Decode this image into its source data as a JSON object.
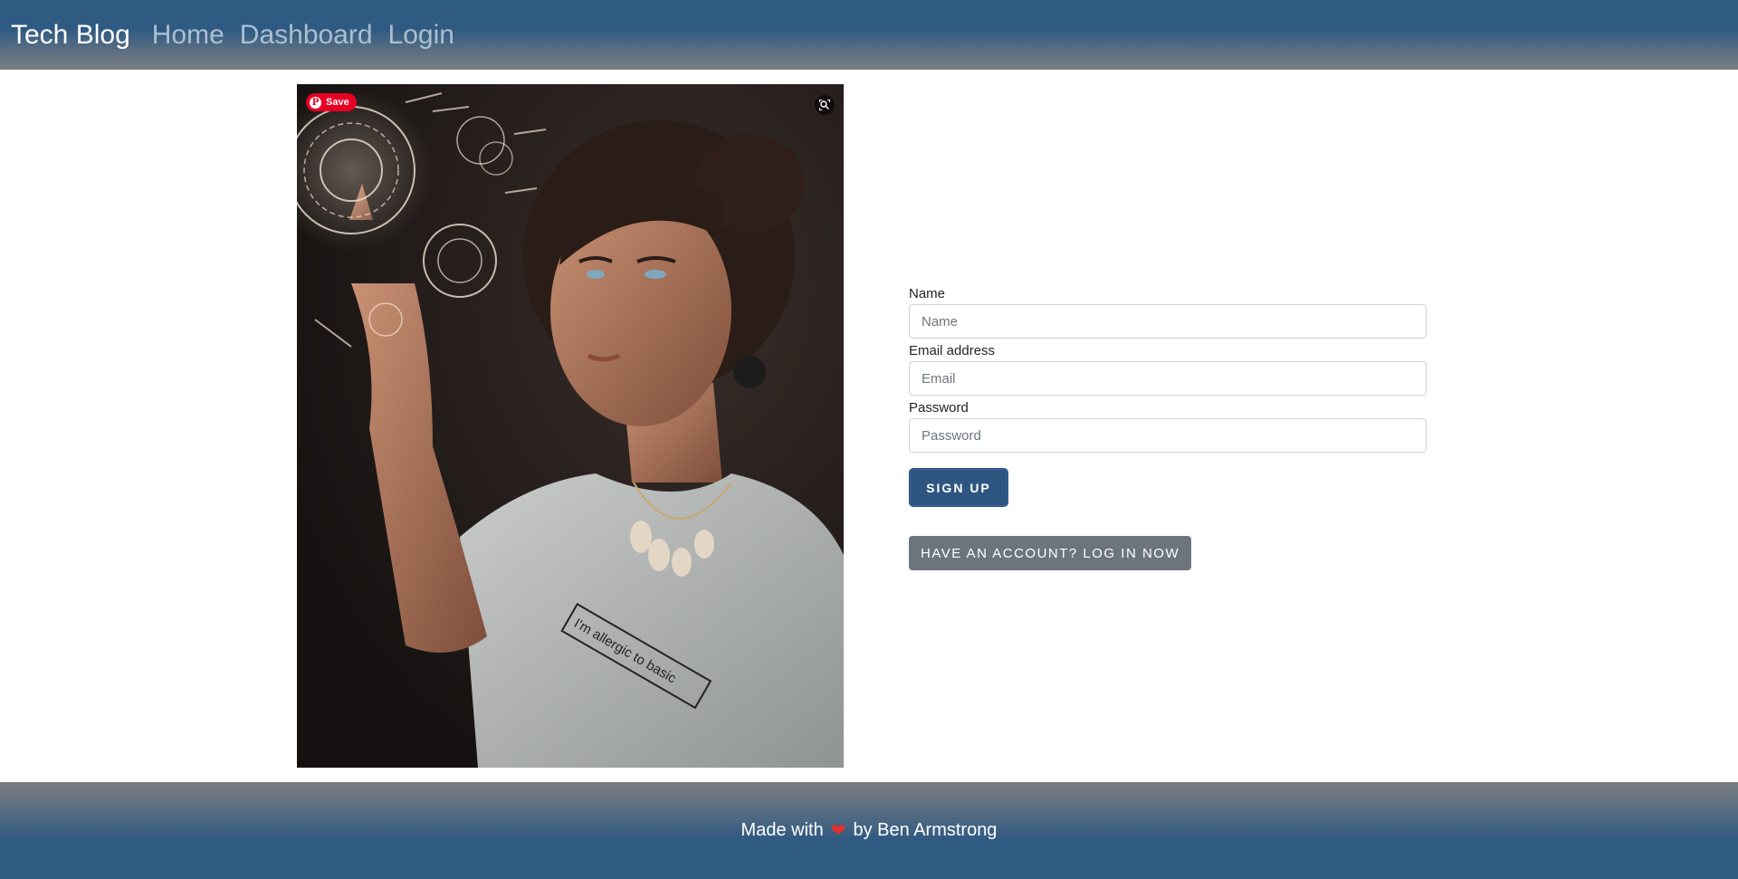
{
  "nav": {
    "brand": "Tech Blog",
    "links": [
      "Home",
      "Dashboard",
      "Login"
    ]
  },
  "hero": {
    "save_label": "Save",
    "pin_logo": "P",
    "shirt_text": "I'm allergic to basic"
  },
  "form": {
    "name_label": "Name",
    "name_placeholder": "Name",
    "email_label": "Email address",
    "email_placeholder": "Email",
    "password_label": "Password",
    "password_placeholder": "Password",
    "signup_label": "SIGN UP",
    "login_label": "HAVE AN ACCOUNT? LOG IN NOW"
  },
  "footer": {
    "made_with": "Made with",
    "heart_icon": "heart-icon",
    "heart_glyph": "❤",
    "by": "by Ben Armstrong"
  },
  "colors": {
    "nav_top": "#2f5a82",
    "nav_bottom": "#7a7d80",
    "signup_bg": "#2f5581",
    "login_bg": "#6c757d",
    "pin_red": "#e60023"
  }
}
